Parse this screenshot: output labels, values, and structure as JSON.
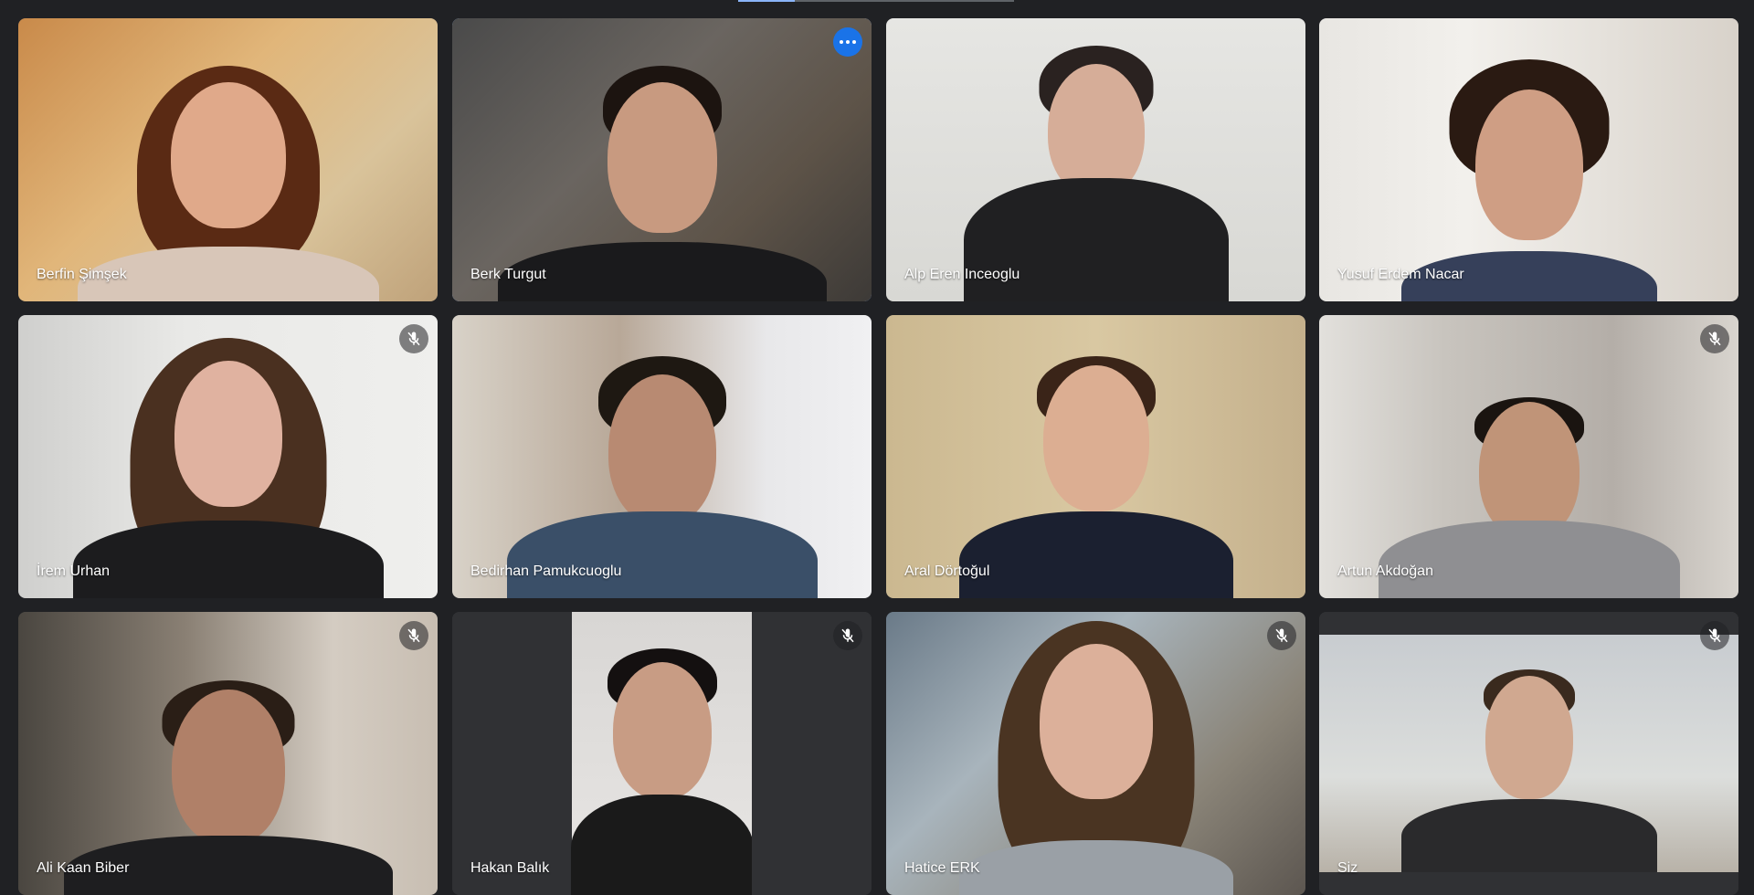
{
  "participants": [
    {
      "name": "Berfin Şimşek",
      "muted": false,
      "active": false
    },
    {
      "name": "Berk Turgut",
      "muted": false,
      "active": true,
      "menu_icon": "more-options-icon"
    },
    {
      "name": "Alp Eren Inceoglu",
      "muted": false,
      "active": false
    },
    {
      "name": "Yusuf Erdem Nacar",
      "muted": false,
      "active": false
    },
    {
      "name": "İrem Urhan",
      "muted": true,
      "active": false
    },
    {
      "name": "Bedirhan Pamukcuoglu",
      "muted": false,
      "active": false
    },
    {
      "name": "Aral Dörtoğul",
      "muted": false,
      "active": false
    },
    {
      "name": "Artun Akdoğan",
      "muted": true,
      "active": false
    },
    {
      "name": "Ali Kaan Biber",
      "muted": true,
      "active": false
    },
    {
      "name": "Hakan Balık",
      "muted": true,
      "active": false
    },
    {
      "name": "Hatice ERK",
      "muted": true,
      "active": false
    },
    {
      "name": "Siz",
      "muted": true,
      "active": false
    }
  ],
  "colors": {
    "background": "#202124",
    "active_border": "#8ab4f8",
    "more_button": "#1a73e8"
  },
  "icons": {
    "muted": "mic-off-icon",
    "more": "more-options-icon"
  }
}
